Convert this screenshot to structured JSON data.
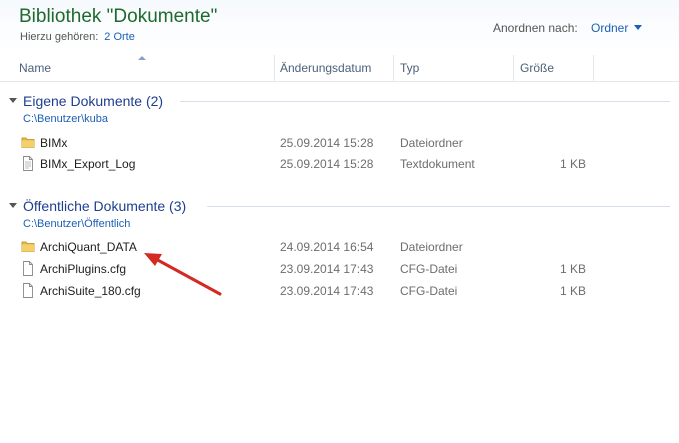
{
  "header": {
    "title": "Bibliothek \"Dokumente\"",
    "belongs_label": "Hierzu gehören:",
    "belongs_link": "2 Orte",
    "arrange_label": "Anordnen nach:",
    "arrange_value": "Ordner"
  },
  "columns": {
    "name": "Name",
    "date": "Änderungsdatum",
    "type": "Typ",
    "size": "Größe"
  },
  "groups": [
    {
      "title": "Eigene Dokumente (2)",
      "path": "C:\\Benutzer\\kuba",
      "items": [
        {
          "icon": "folder-icon",
          "name": "BIMx",
          "date": "25.09.2014 15:28",
          "type": "Dateiordner",
          "size": ""
        },
        {
          "icon": "text-file-icon",
          "name": "BIMx_Export_Log",
          "date": "25.09.2014 15:28",
          "type": "Textdokument",
          "size": "1 KB"
        }
      ]
    },
    {
      "title": "Öffentliche Dokumente (3)",
      "path": "C:\\Benutzer\\Öffentlich",
      "items": [
        {
          "icon": "folder-icon",
          "name": "ArchiQuant_DATA",
          "date": "24.09.2014 16:54",
          "type": "Dateiordner",
          "size": ""
        },
        {
          "icon": "file-icon",
          "name": "ArchiPlugins.cfg",
          "date": "23.09.2014 17:43",
          "type": "CFG-Datei",
          "size": "1 KB"
        },
        {
          "icon": "file-icon",
          "name": "ArchiSuite_180.cfg",
          "date": "23.09.2014 17:43",
          "type": "CFG-Datei",
          "size": "1 KB"
        }
      ]
    }
  ],
  "colors": {
    "title_green": "#1e6a2c",
    "link_blue": "#1c5fb4",
    "group_blue": "#1e3e8f",
    "annotation_red": "#d42a24"
  }
}
